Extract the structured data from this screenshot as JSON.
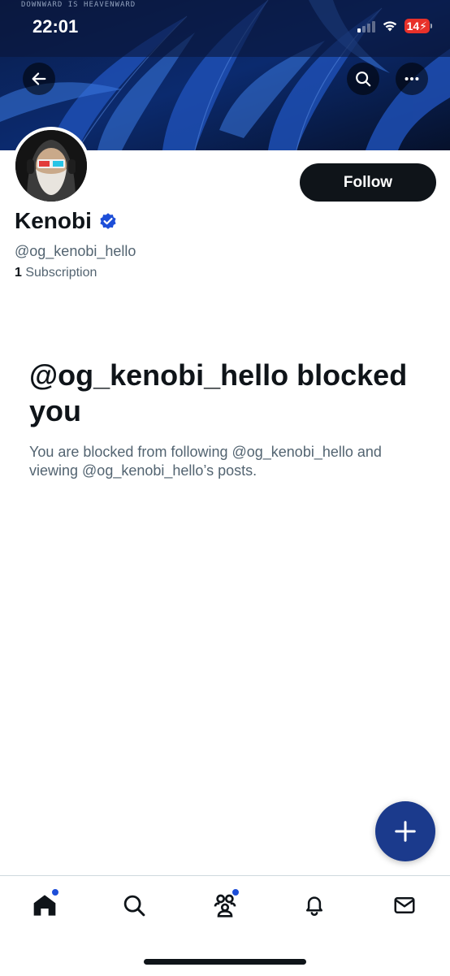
{
  "banner": {
    "caption": "DOWNWARD IS HEAVENWARD"
  },
  "status_bar": {
    "time": "22:01",
    "battery": "14"
  },
  "header_actions": {
    "back_icon": "arrow-left-icon",
    "search_icon": "search-icon",
    "more_icon": "more-horizontal-icon"
  },
  "profile": {
    "display_name": "Kenobi",
    "verified": true,
    "handle": "@og_kenobi_hello",
    "subscription_count": "1",
    "subscription_label": "Subscription",
    "follow_label": "Follow"
  },
  "blocked": {
    "title": "@og_kenobi_hello blocked you",
    "description": "You are blocked from following @og_kenobi_hello and viewing @og_kenobi_hello’s posts."
  },
  "fab": {
    "icon": "plus-icon"
  },
  "tabbar": {
    "items": [
      {
        "name": "home",
        "icon": "home-icon",
        "active": true,
        "badge": true
      },
      {
        "name": "explore",
        "icon": "search-icon",
        "active": false,
        "badge": false
      },
      {
        "name": "communities",
        "icon": "communities-icon",
        "active": false,
        "badge": true
      },
      {
        "name": "notifications",
        "icon": "bell-icon",
        "active": false,
        "badge": false
      },
      {
        "name": "messages",
        "icon": "mail-icon",
        "active": false,
        "badge": false
      }
    ]
  },
  "colors": {
    "accent": "#1d4ed8",
    "fab": "#1b3a8c",
    "text_primary": "#0f1419",
    "text_secondary": "#536471",
    "battery_low": "#e8312a"
  }
}
